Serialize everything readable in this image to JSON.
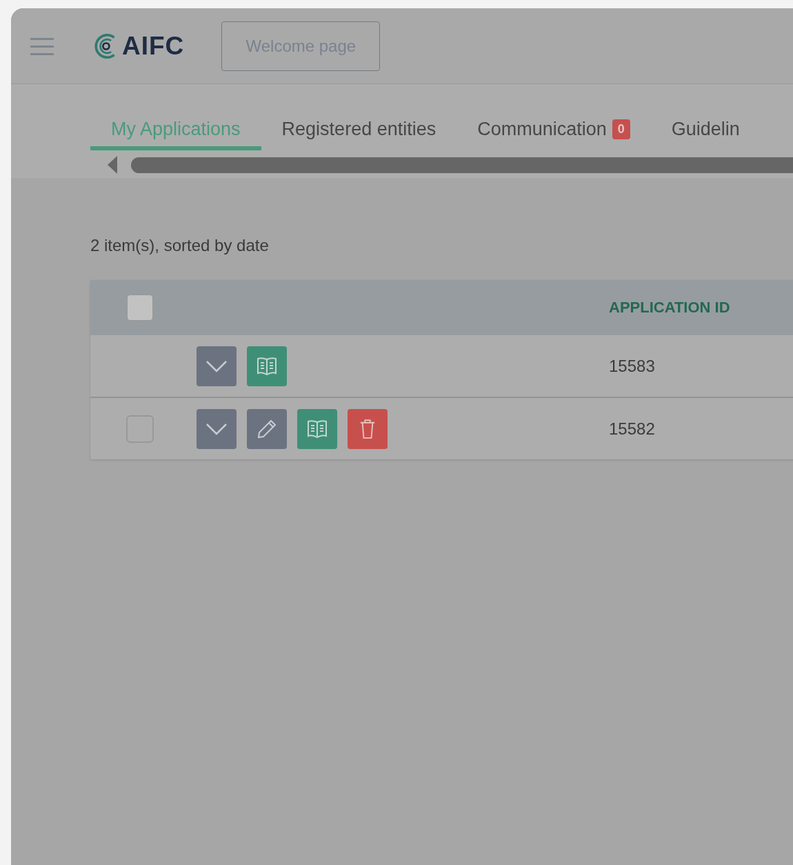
{
  "header": {
    "logo_text": "AIFC",
    "welcome_button": "Welcome page"
  },
  "tabs": [
    {
      "label": "My Applications",
      "selected": true
    },
    {
      "label": "Registered entities",
      "selected": false
    },
    {
      "label": "Communication",
      "selected": false,
      "badge": "0"
    },
    {
      "label": "Guidelin",
      "selected": false
    }
  ],
  "summary": "2 item(s), sorted by date",
  "table": {
    "select_all": {
      "checked": false
    },
    "columns": [
      "APPLICATION ID"
    ],
    "rows": [
      {
        "actions": [
          {
            "kind": "expand"
          },
          {
            "kind": "view"
          }
        ],
        "application_id": "15583"
      },
      {
        "checked": false,
        "actions": [
          {
            "kind": "expand"
          },
          {
            "kind": "edit"
          },
          {
            "kind": "view"
          },
          {
            "kind": "delete"
          }
        ],
        "application_id": "15582"
      }
    ]
  }
}
